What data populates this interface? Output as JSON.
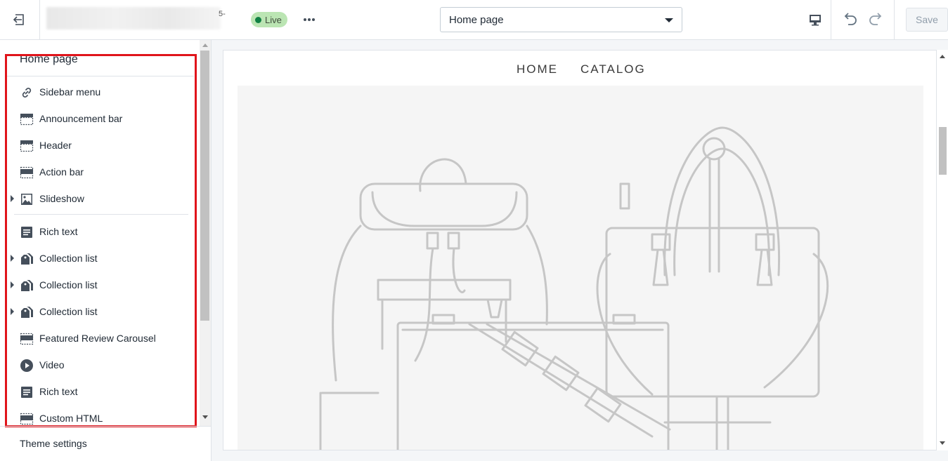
{
  "topbar": {
    "store_suffix": "5-",
    "status_badge": "Live",
    "page_select_value": "Home page",
    "save_label": "Save"
  },
  "sidebar": {
    "title": "Home page",
    "items": [
      {
        "label": "Sidebar menu",
        "icon": "link-icon",
        "expandable": false
      },
      {
        "label": "Announcement bar",
        "icon": "section-header-icon",
        "expandable": false
      },
      {
        "label": "Header",
        "icon": "section-header-icon",
        "expandable": false
      },
      {
        "label": "Action bar",
        "icon": "section-dashed-icon",
        "expandable": false
      },
      {
        "label": "Slideshow",
        "icon": "image-icon",
        "expandable": true
      },
      {
        "label": "Rich text",
        "icon": "text-block-icon",
        "expandable": false
      },
      {
        "label": "Collection list",
        "icon": "tags-icon",
        "expandable": true
      },
      {
        "label": "Collection list",
        "icon": "tags-icon",
        "expandable": true
      },
      {
        "label": "Collection list",
        "icon": "tags-icon",
        "expandable": true
      },
      {
        "label": "Featured Review Carousel",
        "icon": "section-dashed-icon",
        "expandable": false
      },
      {
        "label": "Video",
        "icon": "play-icon",
        "expandable": false
      },
      {
        "label": "Rich text",
        "icon": "text-block-icon",
        "expandable": false
      },
      {
        "label": "Custom HTML",
        "icon": "section-dashed-icon",
        "expandable": false
      }
    ],
    "theme_settings": "Theme settings"
  },
  "preview": {
    "nav": [
      "HOME",
      "CATALOG"
    ],
    "active_nav": "HOME"
  },
  "colors": {
    "highlight": "#e0141b",
    "live_badge_bg": "#bbe5b3",
    "live_dot": "#108043"
  }
}
